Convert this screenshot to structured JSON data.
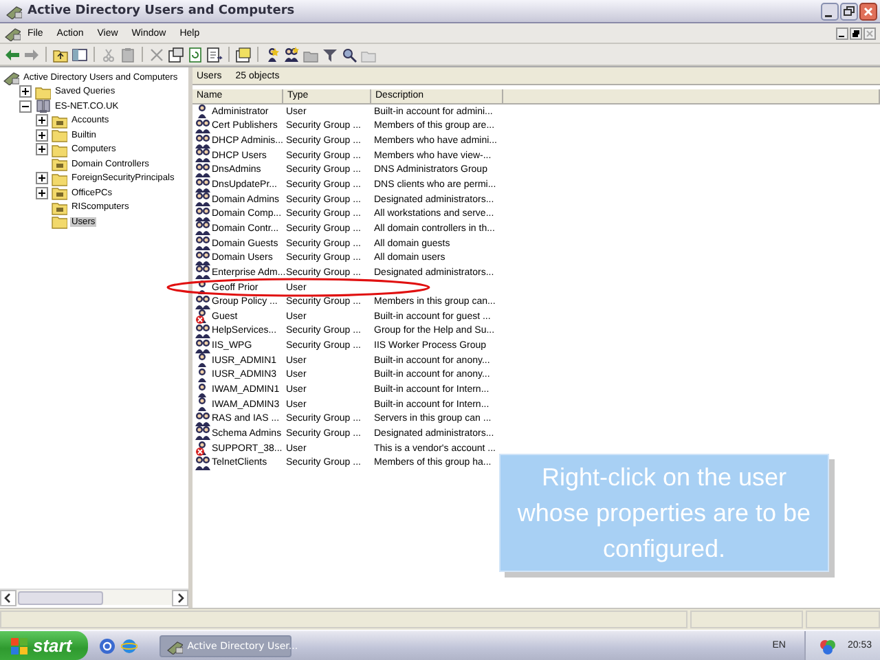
{
  "window": {
    "title": "Active Directory Users and Computers"
  },
  "menu": [
    "File",
    "Action",
    "View",
    "Window",
    "Help"
  ],
  "tree": {
    "label": "Active Directory Users and Computers",
    "children": [
      {
        "label": "Saved Queries",
        "expanded": false,
        "selected": false,
        "kind": "folder"
      },
      {
        "label": "ES-NET.CO.UK",
        "expanded": true,
        "selected": false,
        "kind": "domain",
        "children": [
          {
            "label": "Accounts",
            "expanded": false,
            "selected": false,
            "kind": "ou"
          },
          {
            "label": "Builtin",
            "expanded": false,
            "selected": false,
            "kind": "folder"
          },
          {
            "label": "Computers",
            "expanded": false,
            "selected": false,
            "kind": "folder"
          },
          {
            "label": "Domain Controllers",
            "selected": false,
            "kind": "ou"
          },
          {
            "label": "ForeignSecurityPrincipals",
            "expanded": false,
            "selected": false,
            "kind": "folder"
          },
          {
            "label": "OfficePCs",
            "expanded": false,
            "selected": false,
            "kind": "ou"
          },
          {
            "label": "RIScomputers",
            "selected": false,
            "kind": "ou"
          },
          {
            "label": "Users",
            "selected": true,
            "kind": "folder"
          }
        ]
      }
    ]
  },
  "list_header": {
    "container": "Users",
    "count": "25 objects"
  },
  "table": {
    "columns": [
      "Name",
      "Type",
      "Description"
    ],
    "rows": [
      {
        "kind": "user",
        "disabled": false,
        "circled": false,
        "name": "Administrator",
        "type": "User",
        "description": "Built-in account for admini..."
      },
      {
        "kind": "group",
        "disabled": false,
        "circled": false,
        "name": "Cert Publishers",
        "type": "Security Group ...",
        "description": "Members of this group are..."
      },
      {
        "kind": "group",
        "disabled": false,
        "circled": false,
        "name": "DHCP Adminis...",
        "type": "Security Group ...",
        "description": "Members who have admini..."
      },
      {
        "kind": "group",
        "disabled": false,
        "circled": false,
        "name": "DHCP Users",
        "type": "Security Group ...",
        "description": "Members who have view-..."
      },
      {
        "kind": "group",
        "disabled": false,
        "circled": false,
        "name": "DnsAdmins",
        "type": "Security Group ...",
        "description": "DNS Administrators Group"
      },
      {
        "kind": "group",
        "disabled": false,
        "circled": false,
        "name": "DnsUpdatePr...",
        "type": "Security Group ...",
        "description": "DNS clients who are permi..."
      },
      {
        "kind": "group",
        "disabled": false,
        "circled": false,
        "name": "Domain Admins",
        "type": "Security Group ...",
        "description": "Designated administrators..."
      },
      {
        "kind": "group",
        "disabled": false,
        "circled": false,
        "name": "Domain Comp...",
        "type": "Security Group ...",
        "description": "All workstations and serve..."
      },
      {
        "kind": "group",
        "disabled": false,
        "circled": false,
        "name": "Domain Contr...",
        "type": "Security Group ...",
        "description": "All domain controllers in th..."
      },
      {
        "kind": "group",
        "disabled": false,
        "circled": false,
        "name": "Domain Guests",
        "type": "Security Group ...",
        "description": "All domain guests"
      },
      {
        "kind": "group",
        "disabled": false,
        "circled": false,
        "name": "Domain Users",
        "type": "Security Group ...",
        "description": "All domain users"
      },
      {
        "kind": "group",
        "disabled": false,
        "circled": false,
        "name": "Enterprise Adm...",
        "type": "Security Group ...",
        "description": "Designated administrators..."
      },
      {
        "kind": "user",
        "disabled": false,
        "circled": true,
        "name": "Geoff Prior",
        "type": "User",
        "description": ""
      },
      {
        "kind": "group",
        "disabled": false,
        "circled": false,
        "name": "Group Policy ...",
        "type": "Security Group ...",
        "description": "Members in this group can..."
      },
      {
        "kind": "user",
        "disabled": true,
        "circled": false,
        "name": "Guest",
        "type": "User",
        "description": "Built-in account for guest ..."
      },
      {
        "kind": "group",
        "disabled": false,
        "circled": false,
        "name": "HelpServices...",
        "type": "Security Group ...",
        "description": "Group for the Help and Su..."
      },
      {
        "kind": "group",
        "disabled": false,
        "circled": false,
        "name": "IIS_WPG",
        "type": "Security Group ...",
        "description": "IIS Worker Process Group"
      },
      {
        "kind": "user",
        "disabled": false,
        "circled": false,
        "name": "IUSR_ADMIN1",
        "type": "User",
        "description": "Built-in account for anony..."
      },
      {
        "kind": "user",
        "disabled": false,
        "circled": false,
        "name": "IUSR_ADMIN3",
        "type": "User",
        "description": "Built-in account for anony..."
      },
      {
        "kind": "user",
        "disabled": false,
        "circled": false,
        "name": "IWAM_ADMIN1",
        "type": "User",
        "description": "Built-in account for Intern..."
      },
      {
        "kind": "user",
        "disabled": false,
        "circled": false,
        "name": "IWAM_ADMIN3",
        "type": "User",
        "description": "Built-in account for Intern..."
      },
      {
        "kind": "group",
        "disabled": false,
        "circled": false,
        "name": "RAS and IAS ...",
        "type": "Security Group ...",
        "description": "Servers in this group can ..."
      },
      {
        "kind": "group",
        "disabled": false,
        "circled": false,
        "name": "Schema Admins",
        "type": "Security Group ...",
        "description": "Designated administrators..."
      },
      {
        "kind": "user",
        "disabled": true,
        "circled": false,
        "name": "SUPPORT_38...",
        "type": "User",
        "description": "This is a vendor's account ..."
      },
      {
        "kind": "group",
        "disabled": false,
        "circled": false,
        "name": "TelnetClients",
        "type": "Security Group ...",
        "description": "Members of this group ha..."
      }
    ]
  },
  "callout": {
    "text": "Right-click on the user whose properties are to be configured."
  },
  "taskbar": {
    "start": "start",
    "task": "Active Directory User...",
    "language": "EN",
    "clock": "20:53"
  }
}
